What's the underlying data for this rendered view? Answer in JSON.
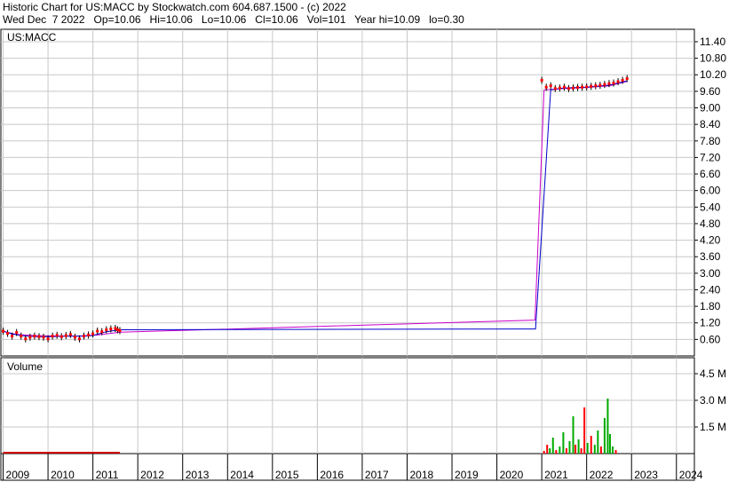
{
  "header": {
    "line1": "Historic Chart for US:MACC by Stockwatch.com 604.687.1500 - (c) 2022",
    "line2": "Wed Dec  7 2022   Op=10.06   Hi=10.06   Lo=10.06   Cl=10.06   Vol=101   Year hi=10.09   lo=0.30"
  },
  "chart_data": [
    {
      "type": "line",
      "series_label": "US:MACC",
      "x_ticks": [
        "2009",
        "2010",
        "2011",
        "2012",
        "2013",
        "2014",
        "2015",
        "2016",
        "2017",
        "2018",
        "2019",
        "2020",
        "2021",
        "2022",
        "2023",
        "2024"
      ],
      "y_ticks": [
        0.6,
        1.2,
        1.8,
        2.4,
        3.0,
        3.6,
        4.2,
        4.8,
        5.4,
        6.0,
        6.6,
        7.2,
        7.8,
        8.4,
        9.0,
        9.6,
        10.2,
        10.8,
        11.4
      ],
      "ylim": [
        0.0,
        11.85
      ],
      "xlim": [
        2008.95,
        2024.4
      ],
      "grid": true,
      "price_series": [
        [
          2009.0,
          0.9
        ],
        [
          2009.1,
          0.82
        ],
        [
          2009.2,
          0.72
        ],
        [
          2009.3,
          0.85
        ],
        [
          2009.4,
          0.72
        ],
        [
          2009.5,
          0.62
        ],
        [
          2009.6,
          0.68
        ],
        [
          2009.7,
          0.72
        ],
        [
          2009.8,
          0.7
        ],
        [
          2009.9,
          0.68
        ],
        [
          2010.0,
          0.62
        ],
        [
          2010.1,
          0.72
        ],
        [
          2010.2,
          0.75
        ],
        [
          2010.3,
          0.7
        ],
        [
          2010.4,
          0.74
        ],
        [
          2010.5,
          0.78
        ],
        [
          2010.6,
          0.68
        ],
        [
          2010.7,
          0.62
        ],
        [
          2010.8,
          0.72
        ],
        [
          2010.9,
          0.76
        ],
        [
          2011.0,
          0.8
        ],
        [
          2011.1,
          0.9
        ],
        [
          2011.2,
          0.88
        ],
        [
          2011.3,
          0.95
        ],
        [
          2011.4,
          0.98
        ],
        [
          2011.5,
          1.0
        ],
        [
          2011.55,
          0.95
        ],
        [
          2011.6,
          0.92
        ],
        [
          2021.0,
          10.0
        ],
        [
          2021.1,
          9.75
        ],
        [
          2021.2,
          9.8
        ],
        [
          2021.3,
          9.7
        ],
        [
          2021.4,
          9.72
        ],
        [
          2021.5,
          9.75
        ],
        [
          2021.6,
          9.7
        ],
        [
          2021.7,
          9.72
        ],
        [
          2021.8,
          9.74
        ],
        [
          2021.9,
          9.75
        ],
        [
          2022.0,
          9.76
        ],
        [
          2022.1,
          9.78
        ],
        [
          2022.2,
          9.8
        ],
        [
          2022.3,
          9.82
        ],
        [
          2022.4,
          9.85
        ],
        [
          2022.5,
          9.88
        ],
        [
          2022.6,
          9.9
        ],
        [
          2022.7,
          9.95
        ],
        [
          2022.8,
          10.0
        ],
        [
          2022.9,
          10.06
        ]
      ],
      "ma_fast": [
        [
          2009.0,
          0.9
        ],
        [
          2009.2,
          0.8
        ],
        [
          2009.5,
          0.72
        ],
        [
          2009.8,
          0.7
        ],
        [
          2010.1,
          0.7
        ],
        [
          2010.4,
          0.72
        ],
        [
          2010.8,
          0.72
        ],
        [
          2011.0,
          0.74
        ],
        [
          2011.3,
          0.88
        ],
        [
          2011.6,
          0.95
        ],
        [
          2020.85,
          0.98
        ],
        [
          2020.86,
          0.98
        ],
        [
          2021.2,
          9.65
        ],
        [
          2021.5,
          9.72
        ],
        [
          2022.0,
          9.75
        ],
        [
          2022.5,
          9.82
        ],
        [
          2022.9,
          9.98
        ]
      ],
      "ma_slow": [
        [
          2009.0,
          0.9
        ],
        [
          2009.3,
          0.78
        ],
        [
          2009.7,
          0.74
        ],
        [
          2010.2,
          0.72
        ],
        [
          2010.7,
          0.72
        ],
        [
          2011.1,
          0.76
        ],
        [
          2011.6,
          0.86
        ],
        [
          2020.85,
          1.3
        ],
        [
          2021.05,
          9.65
        ],
        [
          2021.5,
          9.7
        ],
        [
          2022.0,
          9.74
        ],
        [
          2022.5,
          9.8
        ],
        [
          2022.9,
          9.96
        ]
      ],
      "colors": {
        "price_up": "#ff0000",
        "price_body": "#000000",
        "ma_fast": "#0000cc",
        "ma_slow": "#cc00cc",
        "grid": "#c8c8c8"
      }
    },
    {
      "type": "bar",
      "series_label": "Volume",
      "y_ticks": [
        "1.5 M",
        "3.0 M",
        "4.5 M"
      ],
      "y_tick_values": [
        1500000,
        3000000,
        4500000
      ],
      "ylim": [
        0,
        5400000
      ],
      "volume_bars": [
        [
          2021.05,
          150000,
          "red"
        ],
        [
          2021.12,
          500000,
          "red"
        ],
        [
          2021.18,
          300000,
          "green"
        ],
        [
          2021.25,
          900000,
          "green"
        ],
        [
          2021.32,
          200000,
          "red"
        ],
        [
          2021.4,
          400000,
          "green"
        ],
        [
          2021.48,
          1200000,
          "green"
        ],
        [
          2021.55,
          300000,
          "red"
        ],
        [
          2021.62,
          700000,
          "green"
        ],
        [
          2021.7,
          2100000,
          "green"
        ],
        [
          2021.75,
          500000,
          "red"
        ],
        [
          2021.82,
          800000,
          "green"
        ],
        [
          2021.88,
          300000,
          "red"
        ],
        [
          2021.95,
          2600000,
          "red"
        ],
        [
          2022.02,
          600000,
          "green"
        ],
        [
          2022.1,
          1000000,
          "red"
        ],
        [
          2022.18,
          500000,
          "green"
        ],
        [
          2022.25,
          1300000,
          "green"
        ],
        [
          2022.32,
          400000,
          "red"
        ],
        [
          2022.4,
          2000000,
          "green"
        ],
        [
          2022.47,
          3100000,
          "green"
        ],
        [
          2022.52,
          1100000,
          "green"
        ],
        [
          2022.58,
          400000,
          "green"
        ],
        [
          2022.65,
          200000,
          "red"
        ]
      ],
      "colors": {
        "up": "#00aa00",
        "down": "#ff0000",
        "base": "#cc0000"
      }
    }
  ]
}
